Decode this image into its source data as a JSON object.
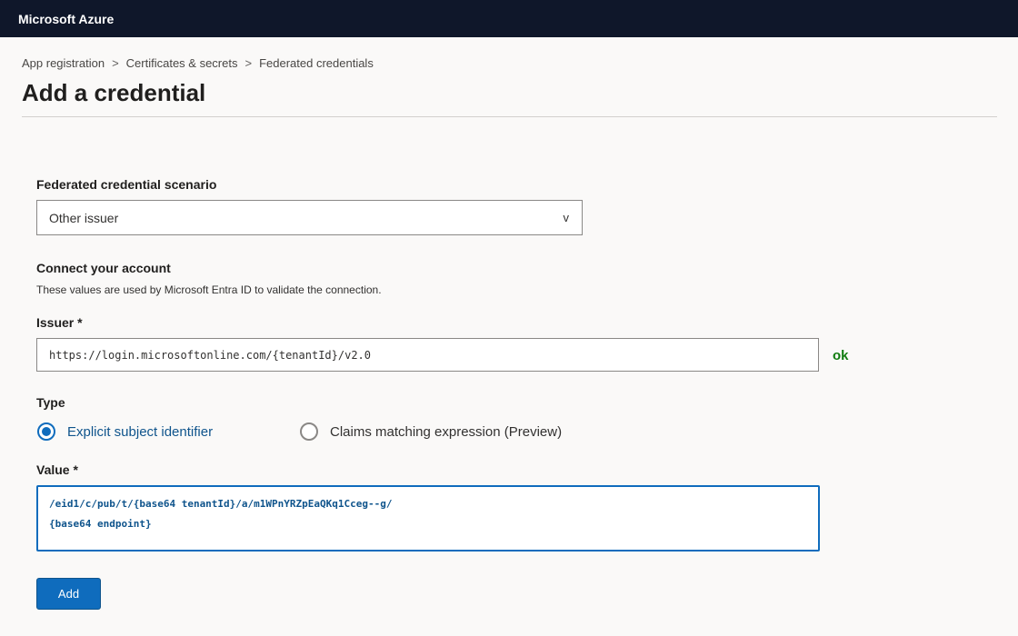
{
  "app": {
    "title": "Microsoft Azure"
  },
  "breadcrumb": {
    "items": [
      "App registration",
      "Certificates & secrets",
      "Federated credentials"
    ],
    "separator": ">"
  },
  "page": {
    "title": "Add a credential"
  },
  "scenario": {
    "label": "Federated credential scenario",
    "selected": "Other issuer",
    "chevron": "v"
  },
  "connect": {
    "heading": "Connect your account",
    "help": "These values are used by Microsoft Entra ID to validate the connection."
  },
  "issuer": {
    "label": "Issuer *",
    "value": "https://login.microsoftonline.com/{tenantId}/v2.0",
    "status": "ok"
  },
  "type": {
    "label": "Type",
    "options": [
      {
        "label": "Explicit subject identifier",
        "checked": true
      },
      {
        "label": "Claims matching expression (Preview)",
        "checked": false
      }
    ]
  },
  "value": {
    "label": "Value *",
    "lines": [
      "/eid1/c/pub/t/{base64 tenantId}/a/m1WPnYRZpEaQKq1Cceg--g/",
      "{base64 endpoint}"
    ]
  },
  "actions": {
    "add_label": "Add"
  },
  "colors": {
    "topbar": "#0f172a",
    "accent": "#0f6cbd",
    "ok": "#107c10"
  }
}
